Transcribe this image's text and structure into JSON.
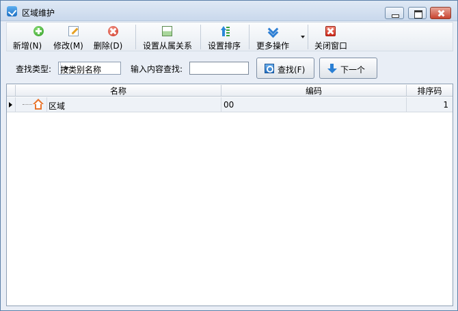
{
  "window": {
    "title": "区域维护"
  },
  "toolbar": {
    "add": "新增(N)",
    "edit": "修改(M)",
    "delete": "删除(D)",
    "set_relation": "设置从属关系",
    "set_sort": "设置排序",
    "more": "更多操作",
    "close": "关闭窗口"
  },
  "search": {
    "type_label": "查找类型:",
    "type_value": "按类别名称",
    "input_label": "输入内容查找:",
    "input_value": "",
    "find_button": "查找(F)",
    "next_button": "下一个"
  },
  "grid": {
    "columns": [
      "名称",
      "编码",
      "排序码"
    ],
    "rows": [
      {
        "name": "区域",
        "code": "00",
        "sort": "1"
      }
    ]
  },
  "colors": {
    "title_bar": "#c9d8ec",
    "accent_blue": "#2a7fd4",
    "row_selected": "#eef2f7"
  }
}
